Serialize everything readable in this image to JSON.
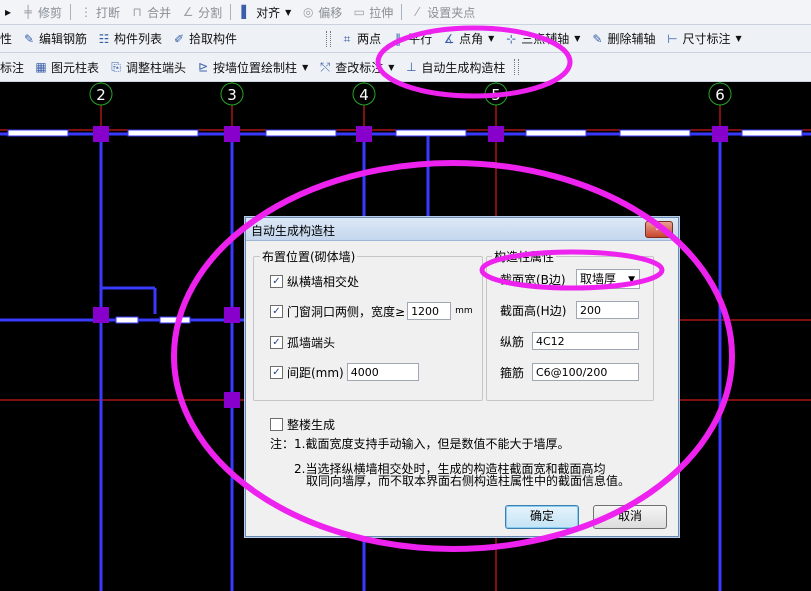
{
  "toolbar1": {
    "items": [
      {
        "icon": "trim-icon",
        "label": "修剪",
        "disabled": true
      },
      {
        "icon": "break-icon",
        "label": "打断",
        "disabled": true
      },
      {
        "icon": "merge-icon",
        "label": "合并",
        "disabled": true
      },
      {
        "icon": "split-icon",
        "label": "分割",
        "disabled": true
      },
      {
        "icon": "align-icon",
        "label": "对齐",
        "disabled": false
      },
      {
        "icon": "offset-icon",
        "label": "偏移",
        "disabled": true
      },
      {
        "icon": "stretch-icon",
        "label": "拉伸",
        "disabled": true
      },
      {
        "icon": "set-grip-icon",
        "label": "设置夹点",
        "disabled": true
      }
    ],
    "prefix": "▸"
  },
  "toolbar2": {
    "prefix": "性",
    "items": [
      {
        "icon": "edit-rebar-icon",
        "label": "编辑钢筋"
      },
      {
        "icon": "component-list-icon",
        "label": "构件列表"
      },
      {
        "icon": "pick-component-icon",
        "label": "拾取构件"
      }
    ],
    "right_items": [
      {
        "icon": "two-point-icon",
        "label": "两点"
      },
      {
        "icon": "parallel-icon",
        "label": "平行"
      },
      {
        "icon": "point-angle-icon",
        "label": "点角"
      },
      {
        "icon": "three-point-axis-icon",
        "label": "三点辅轴"
      },
      {
        "icon": "delete-aux-axis-icon",
        "label": "删除辅轴"
      },
      {
        "icon": "dimension-icon",
        "label": "尺寸标注"
      }
    ]
  },
  "toolbar3": {
    "prefix": "标注",
    "items": [
      {
        "icon": "element-column-table-icon",
        "label": "图元柱表"
      },
      {
        "icon": "adjust-column-end-icon",
        "label": "调整柱端头"
      },
      {
        "icon": "draw-column-by-wall-icon",
        "label": "按墙位置绘制柱"
      },
      {
        "icon": "modify-annotation-icon",
        "label": "查改标注"
      },
      {
        "icon": "auto-construction-column-icon",
        "label": "自动生成构造柱"
      }
    ]
  },
  "axes": [
    "2",
    "3",
    "4",
    "5",
    "6"
  ],
  "dialog": {
    "title": "自动生成构造柱",
    "close_symbol": "✕",
    "group_position": "布置位置(砌体墙)",
    "opt_intersection": "纵横墙相交处",
    "opt_opening": "门窗洞口两侧，宽度≥",
    "opening_width": "1200",
    "opening_unit": "mm",
    "opt_isolated_end": "孤墙端头",
    "opt_spacing": "间距(mm)",
    "spacing_value": "4000",
    "group_attr": "构造柱属性",
    "attr_width_label": "截面宽(B边)",
    "attr_width_value": "取墙厚",
    "attr_height_label": "截面高(H边)",
    "attr_height_value": "200",
    "attr_long_rebar_label": "纵筋",
    "attr_long_rebar_value": "4C12",
    "attr_stirrup_label": "箍筋",
    "attr_stirrup_value": "C6@100/200",
    "opt_whole_floor": "整楼生成",
    "note1": "注：1.截面宽度支持手动输入，但是数值不能大于墙厚。",
    "note2a": "2.当选择纵横墙相交处时，生成的构造柱截面宽和截面高均",
    "note2b": "取同向墙厚，而不取本界面右侧构造柱属性中的截面信息值。",
    "ok": "确定",
    "cancel": "取消"
  },
  "colors": {
    "highlight": "#ee22ee",
    "axis_line": "#ff2020",
    "wall": "#3a3aff",
    "column": "#8800cc",
    "grid": "#26a626"
  }
}
